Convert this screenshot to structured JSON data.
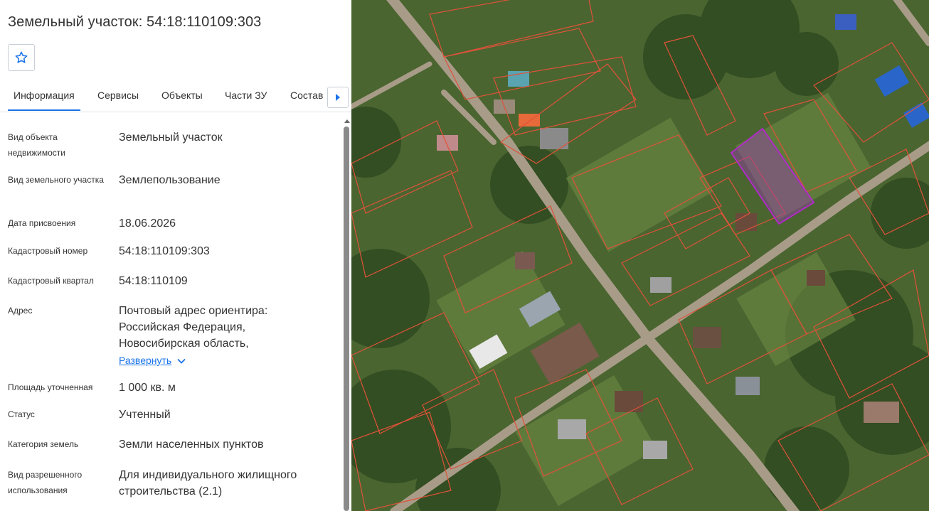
{
  "panel": {
    "title": "Земельный участок: 54:18:110109:303",
    "favorite_icon": "star-outline-icon",
    "tabs": [
      "Информация",
      "Сервисы",
      "Объекты",
      "Части ЗУ",
      "Состав"
    ],
    "active_tab": "Информация",
    "tab_scroll_icon": "caret-right-icon",
    "rows": [
      {
        "label": "Вид объекта недвижимости",
        "value": "Земельный участок"
      },
      {
        "label": "Вид земельного участка",
        "value": "Землепользование"
      },
      {
        "label": "Дата присвоения",
        "value": "18.06.2026"
      },
      {
        "label": "Кадастровый номер",
        "value": "54:18:110109:303"
      },
      {
        "label": "Кадастровый квартал",
        "value": "54:18:110109"
      },
      {
        "label": "Адрес",
        "value": "Почтовый адрес ориентира: Российская Федерация, Новосибирская область,"
      },
      {
        "label": "Площадь уточненная",
        "value": "1 000 кв. м"
      },
      {
        "label": "Статус",
        "value": "Учтенный"
      },
      {
        "label": "Категория земель",
        "value": "Земли населенных пунктов"
      },
      {
        "label": "Вид разрешенного использования",
        "value": "Для индивидуального жилищного строительства (2.1)"
      }
    ],
    "expand_label": "Развернуть",
    "expand_icon": "chevron-down-icon"
  },
  "colors": {
    "accent": "#1a73e8",
    "parcel_border": "#e0523a",
    "selected_parcel": "#b02bc7"
  }
}
